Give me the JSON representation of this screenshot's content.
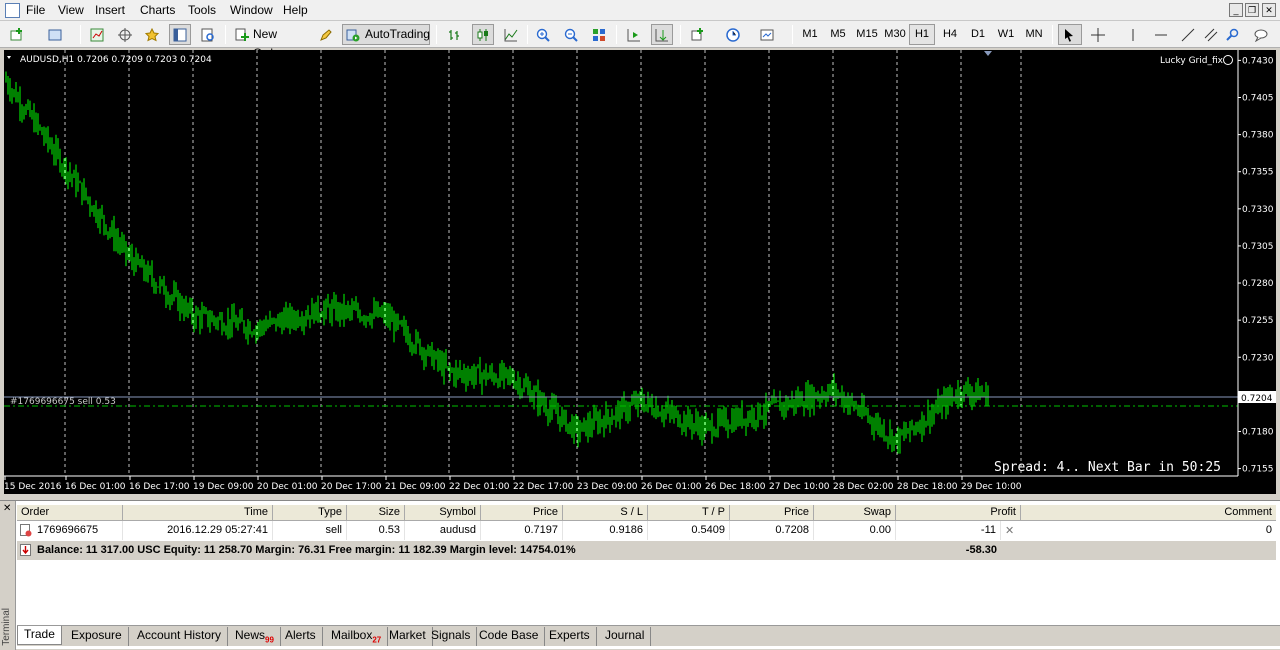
{
  "menu": [
    "File",
    "View",
    "Insert",
    "Charts",
    "Tools",
    "Window",
    "Help"
  ],
  "toolbar": {
    "new_order": "New Order",
    "autotrading": "AutoTrading",
    "timeframes": [
      "M1",
      "M5",
      "M15",
      "M30",
      "H1",
      "H4",
      "D1",
      "W1",
      "MN"
    ],
    "active_timeframe": "H1"
  },
  "chart": {
    "header": "AUDUSD,H1  0.7206 0.7209 0.7203 0.7204",
    "ea_label": "Lucky Grid_fix",
    "order_line_label": "#1769696675 sell 0.53",
    "current_price": "0.7204",
    "status_text": "Spread: 4.. Next Bar in 50:25",
    "colors": {
      "background": "#000000",
      "candle": "#00ff00",
      "grid": "#c0c0c0",
      "bid_line": "#8899bb",
      "order_line": "#00c000"
    },
    "y_ticks": [
      "0.7430",
      "0.7405",
      "0.7380",
      "0.7355",
      "0.7330",
      "0.7305",
      "0.7280",
      "0.7255",
      "0.7230",
      "0.7204",
      "0.7180",
      "0.7155"
    ],
    "x_ticks": [
      "15 Dec 2016",
      "16 Dec 01:00",
      "16 Dec 17:00",
      "19 Dec 09:00",
      "20 Dec 01:00",
      "20 Dec 17:00",
      "21 Dec 09:00",
      "22 Dec 01:00",
      "22 Dec 17:00",
      "23 Dec 09:00",
      "26 Dec 01:00",
      "26 Dec 18:00",
      "27 Dec 10:00",
      "28 Dec 02:00",
      "28 Dec 18:00",
      "29 Dec 10:00"
    ]
  },
  "chart_data": {
    "type": "line",
    "title": "AUDUSD,H1",
    "xlabel": "",
    "ylabel": "",
    "ylim": [
      0.715,
      0.7437
    ],
    "x": [
      "15 Dec 2016",
      "16 Dec 01:00",
      "16 Dec 17:00",
      "19 Dec 09:00",
      "20 Dec 01:00",
      "20 Dec 17:00",
      "21 Dec 09:00",
      "22 Dec 01:00",
      "22 Dec 17:00",
      "23 Dec 09:00",
      "26 Dec 01:00",
      "26 Dec 18:00",
      "27 Dec 10:00",
      "28 Dec 02:00",
      "28 Dec 18:00",
      "29 Dec 10:00"
    ],
    "series": [
      {
        "name": "AUDUSD",
        "values": [
          0.7418,
          0.7358,
          0.7297,
          0.7258,
          0.725,
          0.7262,
          0.7258,
          0.722,
          0.7216,
          0.718,
          0.72,
          0.7182,
          0.7195,
          0.7208,
          0.7174,
          0.7208
        ]
      }
    ],
    "grid": true
  },
  "terminal": {
    "columns": [
      "Order",
      "Time",
      "Type",
      "Size",
      "Symbol",
      "Price",
      "S / L",
      "T / P",
      "Price",
      "Swap",
      "Profit",
      "Comment"
    ],
    "rows": [
      {
        "order": "1769696675",
        "time": "2016.12.29 05:27:41",
        "type": "sell",
        "size": "0.53",
        "symbol": "audusd",
        "price": "0.7197",
        "sl": "0.9186",
        "tp": "0.5409",
        "cur_price": "0.7208",
        "swap": "0.00",
        "profit": "-11",
        "comment": "0"
      }
    ],
    "balance_line": "Balance: 11 317.00 USC  Equity: 11 258.70  Margin: 76.31  Free margin: 11 182.39  Margin level: 14754.01%",
    "total_profit": "-58.30",
    "side_label": "Terminal",
    "tabs": [
      {
        "label": "Trade",
        "badge": ""
      },
      {
        "label": "Exposure",
        "badge": ""
      },
      {
        "label": "Account History",
        "badge": ""
      },
      {
        "label": "News",
        "badge": "99"
      },
      {
        "label": "Alerts",
        "badge": ""
      },
      {
        "label": "Mailbox",
        "badge": "27"
      },
      {
        "label": "Market",
        "badge": ""
      },
      {
        "label": "Signals",
        "badge": ""
      },
      {
        "label": "Code Base",
        "badge": ""
      },
      {
        "label": "Experts",
        "badge": ""
      },
      {
        "label": "Journal",
        "badge": ""
      }
    ]
  }
}
